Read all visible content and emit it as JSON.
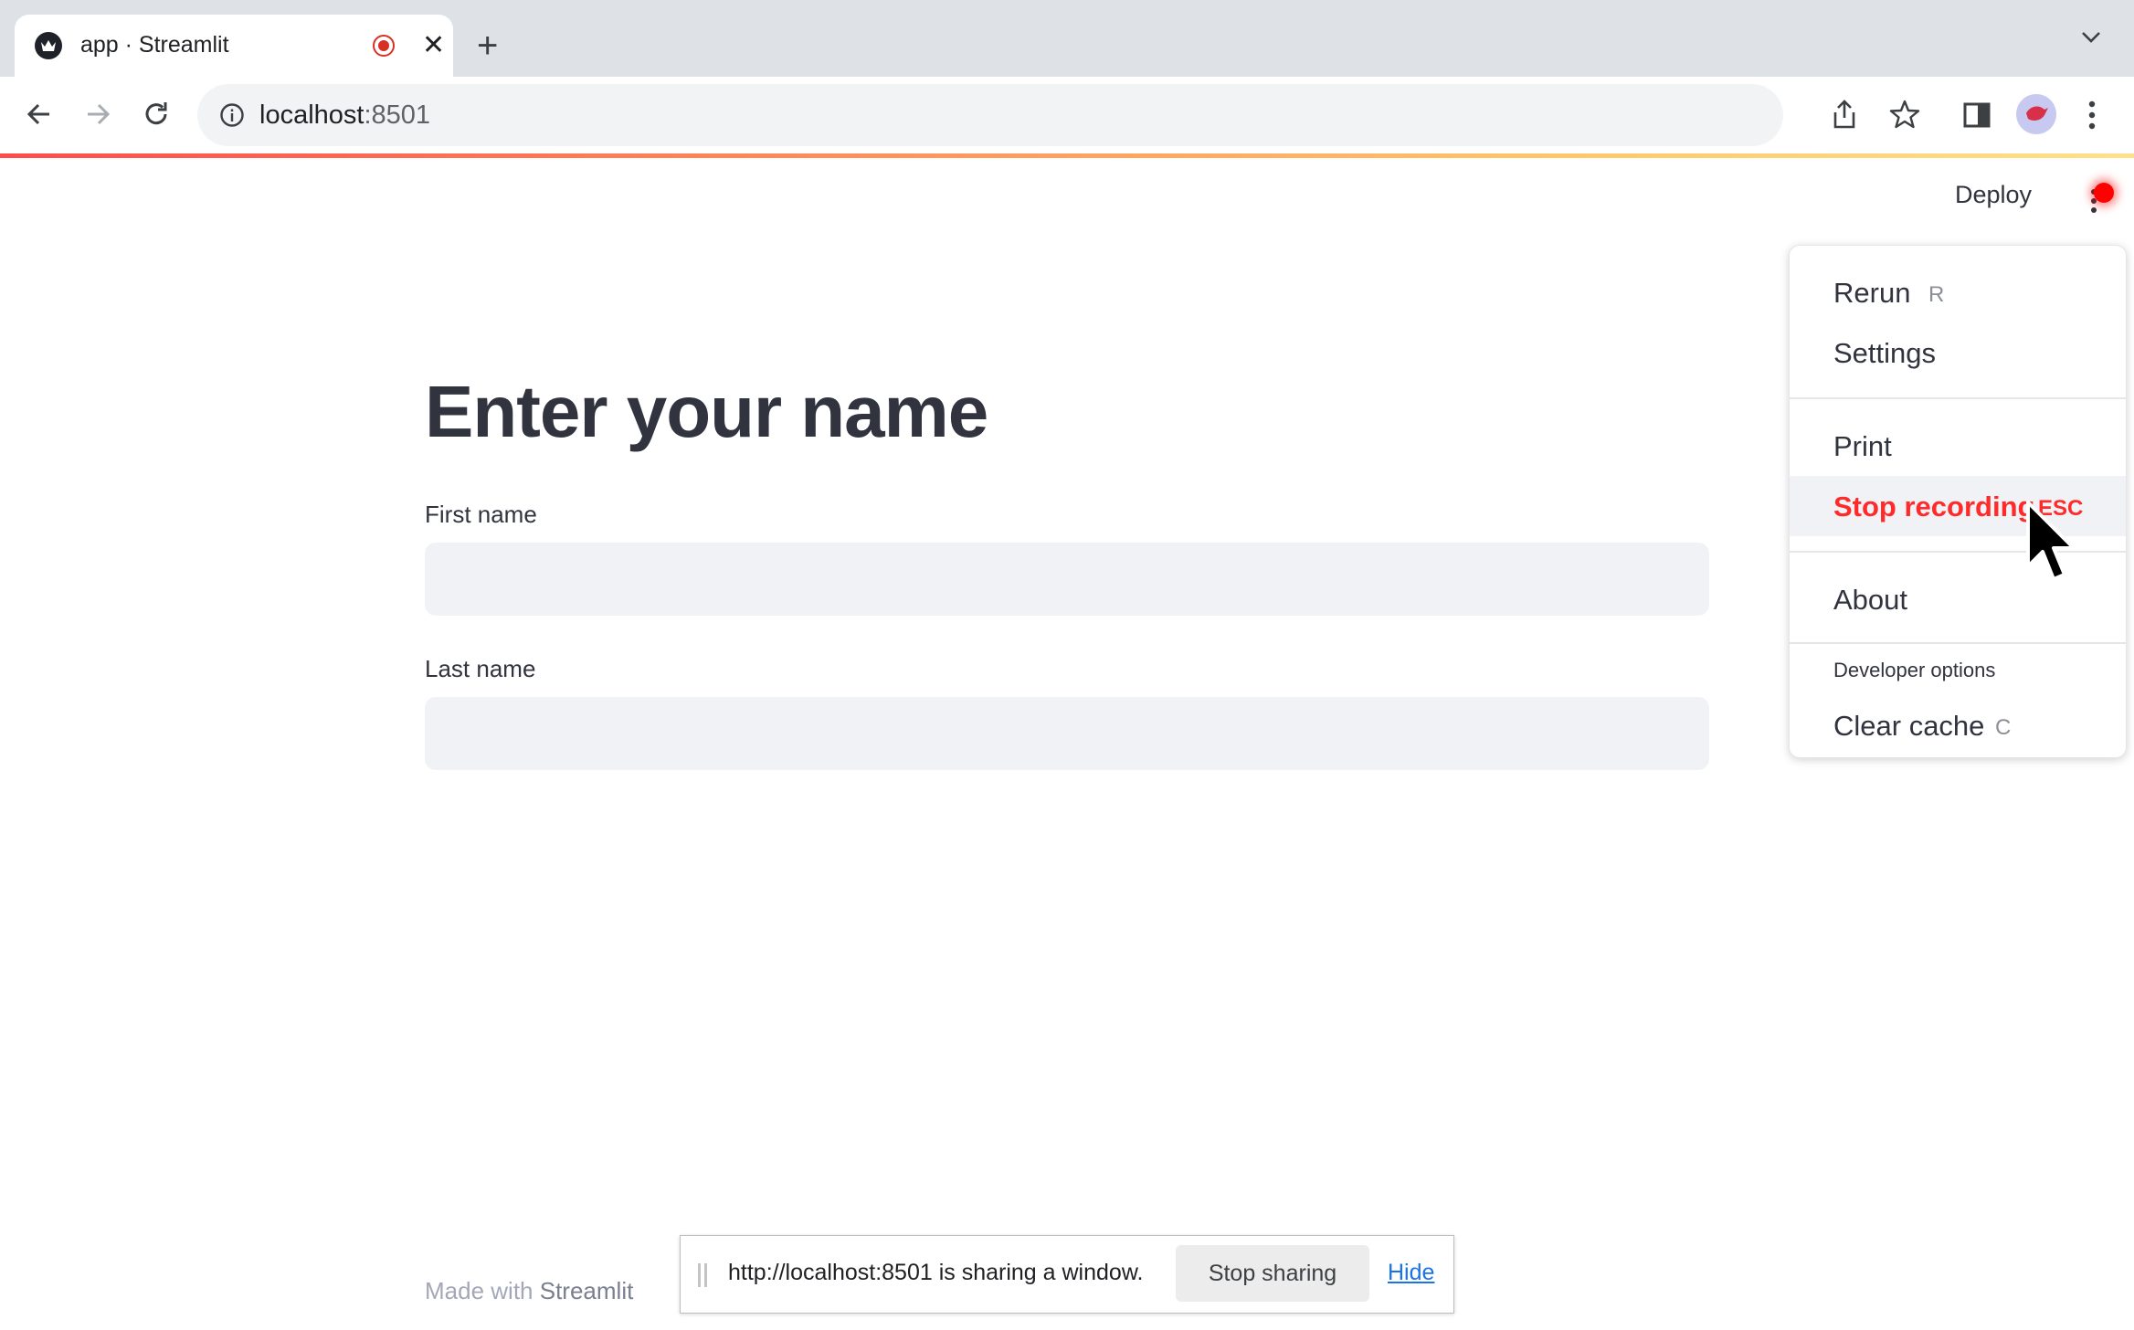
{
  "browser": {
    "tab_title": "app · Streamlit",
    "tab_close": "✕",
    "new_tab": "+",
    "url_host": "localhost",
    "url_port": ":8501"
  },
  "header": {
    "deploy_label": "Deploy"
  },
  "main": {
    "title": "Enter your name",
    "fields": [
      {
        "label": "First name",
        "value": ""
      },
      {
        "label": "Last name",
        "value": ""
      }
    ]
  },
  "menu": {
    "items": [
      {
        "label": "Rerun",
        "shortcut": "R"
      },
      {
        "label": "Settings",
        "shortcut": ""
      },
      {
        "label": "Print",
        "shortcut": ""
      },
      {
        "label": "Stop recording",
        "shortcut": "ESC"
      },
      {
        "label": "About",
        "shortcut": ""
      },
      {
        "label": "Clear cache",
        "shortcut": "C"
      }
    ],
    "developer_heading": "Developer options"
  },
  "footer": {
    "prefix": "Made with ",
    "brand": "Streamlit"
  },
  "sharing_bar": {
    "message": "http://localhost:8501 is sharing a window.",
    "stop_label": "Stop sharing",
    "hide_label": "Hide"
  },
  "colors": {
    "accent_red": "#ff2b2b",
    "input_bg": "#f0f2f6",
    "link_blue": "#1a73e8"
  }
}
